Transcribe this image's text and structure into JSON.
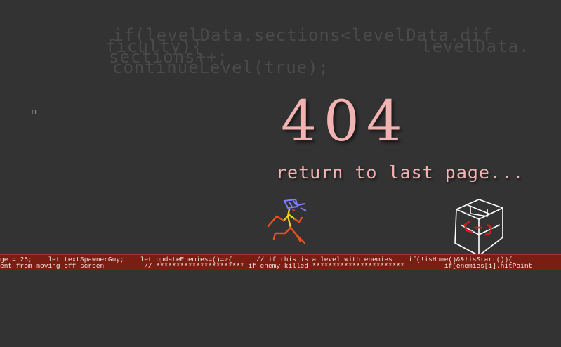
{
  "background_code": {
    "line1": "if(levelData.sections<levelData.dif",
    "line2": "ficulty){",
    "line3": "levelData.",
    "line4": "sections++;",
    "line5": "continueLevel(true);"
  },
  "stray_char": "m",
  "error_code": "404",
  "return_link": "return to last page...",
  "ground": {
    "line1": "ge = 26;    let textSpawnerGuy;    let updateEnemies=()=>{      // if this is a level with enemies    if(!isHome()&&!isStart()){",
    "line2": "ent from moving off screen          // ********************** if enemy killed ***********************          if(enemies[i].hitPoint"
  },
  "colors": {
    "background": "#333333",
    "accent_text": "#f2b3b3",
    "ground": "#7a1d12",
    "player_body": "#f0d020",
    "player_legs": "#e8501e",
    "player_helmet": "#8080ff",
    "cube_outline": "#ffffff",
    "cube_marks": "#d42020"
  },
  "icons": {
    "player": "stick-figure-runner",
    "enemy": "wireframe-cube"
  }
}
